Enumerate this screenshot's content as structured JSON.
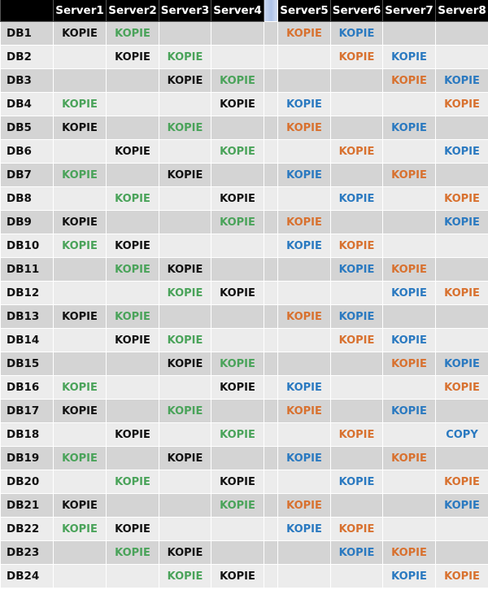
{
  "table": {
    "columns": [
      "Server1",
      "Server2",
      "Server3",
      "Server4",
      "Server5",
      "Server6",
      "Server7",
      "Server8"
    ],
    "colors": {
      "black": "#111111",
      "green": "#4aa35a",
      "orange": "#d8712f",
      "blue": "#2a79c0"
    },
    "rows": [
      {
        "label": "DB1",
        "cells": [
          [
            "KOPIE",
            "black"
          ],
          [
            "KOPIE",
            "green"
          ],
          [
            "",
            ""
          ],
          [
            "",
            ""
          ],
          [
            "KOPIE",
            "orange"
          ],
          [
            "KOPIE",
            "blue"
          ],
          [
            "",
            ""
          ],
          [
            "",
            ""
          ]
        ]
      },
      {
        "label": "DB2",
        "cells": [
          [
            "",
            ""
          ],
          [
            "KOPIE",
            "black"
          ],
          [
            "KOPIE",
            "green"
          ],
          [
            "",
            ""
          ],
          [
            "",
            ""
          ],
          [
            "KOPIE",
            "orange"
          ],
          [
            "KOPIE",
            "blue"
          ],
          [
            "",
            ""
          ]
        ]
      },
      {
        "label": "DB3",
        "cells": [
          [
            "",
            ""
          ],
          [
            "",
            ""
          ],
          [
            "KOPIE",
            "black"
          ],
          [
            "KOPIE",
            "green"
          ],
          [
            "",
            ""
          ],
          [
            "",
            ""
          ],
          [
            "KOPIE",
            "orange"
          ],
          [
            "KOPIE",
            "blue"
          ]
        ]
      },
      {
        "label": "DB4",
        "cells": [
          [
            "KOPIE",
            "green"
          ],
          [
            "",
            ""
          ],
          [
            "",
            ""
          ],
          [
            "KOPIE",
            "black"
          ],
          [
            "KOPIE",
            "blue"
          ],
          [
            "",
            ""
          ],
          [
            "",
            ""
          ],
          [
            "KOPIE",
            "orange"
          ]
        ]
      },
      {
        "label": "DB5",
        "cells": [
          [
            "KOPIE",
            "black"
          ],
          [
            "",
            ""
          ],
          [
            "KOPIE",
            "green"
          ],
          [
            "",
            ""
          ],
          [
            "KOPIE",
            "orange"
          ],
          [
            "",
            ""
          ],
          [
            "KOPIE",
            "blue"
          ],
          [
            "",
            ""
          ]
        ]
      },
      {
        "label": "DB6",
        "cells": [
          [
            "",
            ""
          ],
          [
            "KOPIE",
            "black"
          ],
          [
            "",
            ""
          ],
          [
            "KOPIE",
            "green"
          ],
          [
            "",
            ""
          ],
          [
            "KOPIE",
            "orange"
          ],
          [
            "",
            ""
          ],
          [
            "KOPIE",
            "blue"
          ]
        ]
      },
      {
        "label": "DB7",
        "cells": [
          [
            "KOPIE",
            "green"
          ],
          [
            "",
            ""
          ],
          [
            "KOPIE",
            "black"
          ],
          [
            "",
            ""
          ],
          [
            "KOPIE",
            "blue"
          ],
          [
            "",
            ""
          ],
          [
            "KOPIE",
            "orange"
          ],
          [
            "",
            ""
          ]
        ]
      },
      {
        "label": "DB8",
        "cells": [
          [
            "",
            ""
          ],
          [
            "KOPIE",
            "green"
          ],
          [
            "",
            ""
          ],
          [
            "KOPIE",
            "black"
          ],
          [
            "",
            ""
          ],
          [
            "KOPIE",
            "blue"
          ],
          [
            "",
            ""
          ],
          [
            "KOPIE",
            "orange"
          ]
        ]
      },
      {
        "label": "DB9",
        "cells": [
          [
            "KOPIE",
            "black"
          ],
          [
            "",
            ""
          ],
          [
            "",
            ""
          ],
          [
            "KOPIE",
            "green"
          ],
          [
            "KOPIE",
            "orange"
          ],
          [
            "",
            ""
          ],
          [
            "",
            ""
          ],
          [
            "KOPIE",
            "blue"
          ]
        ]
      },
      {
        "label": "DB10",
        "cells": [
          [
            "KOPIE",
            "green"
          ],
          [
            "KOPIE",
            "black"
          ],
          [
            "",
            ""
          ],
          [
            "",
            ""
          ],
          [
            "KOPIE",
            "blue"
          ],
          [
            "KOPIE",
            "orange"
          ],
          [
            "",
            ""
          ],
          [
            "",
            ""
          ]
        ]
      },
      {
        "label": "DB11",
        "cells": [
          [
            "",
            ""
          ],
          [
            "KOPIE",
            "green"
          ],
          [
            "KOPIE",
            "black"
          ],
          [
            "",
            ""
          ],
          [
            "",
            ""
          ],
          [
            "KOPIE",
            "blue"
          ],
          [
            "KOPIE",
            "orange"
          ],
          [
            "",
            ""
          ]
        ]
      },
      {
        "label": "DB12",
        "cells": [
          [
            "",
            ""
          ],
          [
            "",
            ""
          ],
          [
            "KOPIE",
            "green"
          ],
          [
            "KOPIE",
            "black"
          ],
          [
            "",
            ""
          ],
          [
            "",
            ""
          ],
          [
            "KOPIE",
            "blue"
          ],
          [
            "KOPIE",
            "orange"
          ]
        ]
      },
      {
        "label": "DB13",
        "cells": [
          [
            "KOPIE",
            "black"
          ],
          [
            "KOPIE",
            "green"
          ],
          [
            "",
            ""
          ],
          [
            "",
            ""
          ],
          [
            "KOPIE",
            "orange"
          ],
          [
            "KOPIE",
            "blue"
          ],
          [
            "",
            ""
          ],
          [
            "",
            ""
          ]
        ]
      },
      {
        "label": "DB14",
        "cells": [
          [
            "",
            ""
          ],
          [
            "KOPIE",
            "black"
          ],
          [
            "KOPIE",
            "green"
          ],
          [
            "",
            ""
          ],
          [
            "",
            ""
          ],
          [
            "KOPIE",
            "orange"
          ],
          [
            "KOPIE",
            "blue"
          ],
          [
            "",
            ""
          ]
        ]
      },
      {
        "label": "DB15",
        "cells": [
          [
            "",
            ""
          ],
          [
            "",
            ""
          ],
          [
            "KOPIE",
            "black"
          ],
          [
            "KOPIE",
            "green"
          ],
          [
            "",
            ""
          ],
          [
            "",
            ""
          ],
          [
            "KOPIE",
            "orange"
          ],
          [
            "KOPIE",
            "blue"
          ]
        ]
      },
      {
        "label": "DB16",
        "cells": [
          [
            "KOPIE",
            "green"
          ],
          [
            "",
            ""
          ],
          [
            "",
            ""
          ],
          [
            "KOPIE",
            "black"
          ],
          [
            "KOPIE",
            "blue"
          ],
          [
            "",
            ""
          ],
          [
            "",
            ""
          ],
          [
            "KOPIE",
            "orange"
          ]
        ]
      },
      {
        "label": "DB17",
        "cells": [
          [
            "KOPIE",
            "black"
          ],
          [
            "",
            ""
          ],
          [
            "KOPIE",
            "green"
          ],
          [
            "",
            ""
          ],
          [
            "KOPIE",
            "orange"
          ],
          [
            "",
            ""
          ],
          [
            "KOPIE",
            "blue"
          ],
          [
            "",
            ""
          ]
        ]
      },
      {
        "label": "DB18",
        "cells": [
          [
            "",
            ""
          ],
          [
            "KOPIE",
            "black"
          ],
          [
            "",
            ""
          ],
          [
            "KOPIE",
            "green"
          ],
          [
            "",
            ""
          ],
          [
            "KOPIE",
            "orange"
          ],
          [
            "",
            ""
          ],
          [
            "COPY",
            "blue"
          ]
        ]
      },
      {
        "label": "DB19",
        "cells": [
          [
            "KOPIE",
            "green"
          ],
          [
            "",
            ""
          ],
          [
            "KOPIE",
            "black"
          ],
          [
            "",
            ""
          ],
          [
            "KOPIE",
            "blue"
          ],
          [
            "",
            ""
          ],
          [
            "KOPIE",
            "orange"
          ],
          [
            "",
            ""
          ]
        ]
      },
      {
        "label": "DB20",
        "cells": [
          [
            "",
            ""
          ],
          [
            "KOPIE",
            "green"
          ],
          [
            "",
            ""
          ],
          [
            "KOPIE",
            "black"
          ],
          [
            "",
            ""
          ],
          [
            "KOPIE",
            "blue"
          ],
          [
            "",
            ""
          ],
          [
            "KOPIE",
            "orange"
          ]
        ]
      },
      {
        "label": "DB21",
        "cells": [
          [
            "KOPIE",
            "black"
          ],
          [
            "",
            ""
          ],
          [
            "",
            ""
          ],
          [
            "KOPIE",
            "green"
          ],
          [
            "KOPIE",
            "orange"
          ],
          [
            "",
            ""
          ],
          [
            "",
            ""
          ],
          [
            "KOPIE",
            "blue"
          ]
        ]
      },
      {
        "label": "DB22",
        "cells": [
          [
            "KOPIE",
            "green"
          ],
          [
            "KOPIE",
            "black"
          ],
          [
            "",
            ""
          ],
          [
            "",
            ""
          ],
          [
            "KOPIE",
            "blue"
          ],
          [
            "KOPIE",
            "orange"
          ],
          [
            "",
            ""
          ],
          [
            "",
            ""
          ]
        ]
      },
      {
        "label": "DB23",
        "cells": [
          [
            "",
            ""
          ],
          [
            "KOPIE",
            "green"
          ],
          [
            "KOPIE",
            "black"
          ],
          [
            "",
            ""
          ],
          [
            "",
            ""
          ],
          [
            "KOPIE",
            "blue"
          ],
          [
            "KOPIE",
            "orange"
          ],
          [
            "",
            ""
          ]
        ]
      },
      {
        "label": "DB24",
        "cells": [
          [
            "",
            ""
          ],
          [
            "",
            ""
          ],
          [
            "KOPIE",
            "green"
          ],
          [
            "KOPIE",
            "black"
          ],
          [
            "",
            ""
          ],
          [
            "",
            ""
          ],
          [
            "KOPIE",
            "blue"
          ],
          [
            "KOPIE",
            "orange"
          ]
        ]
      }
    ]
  }
}
